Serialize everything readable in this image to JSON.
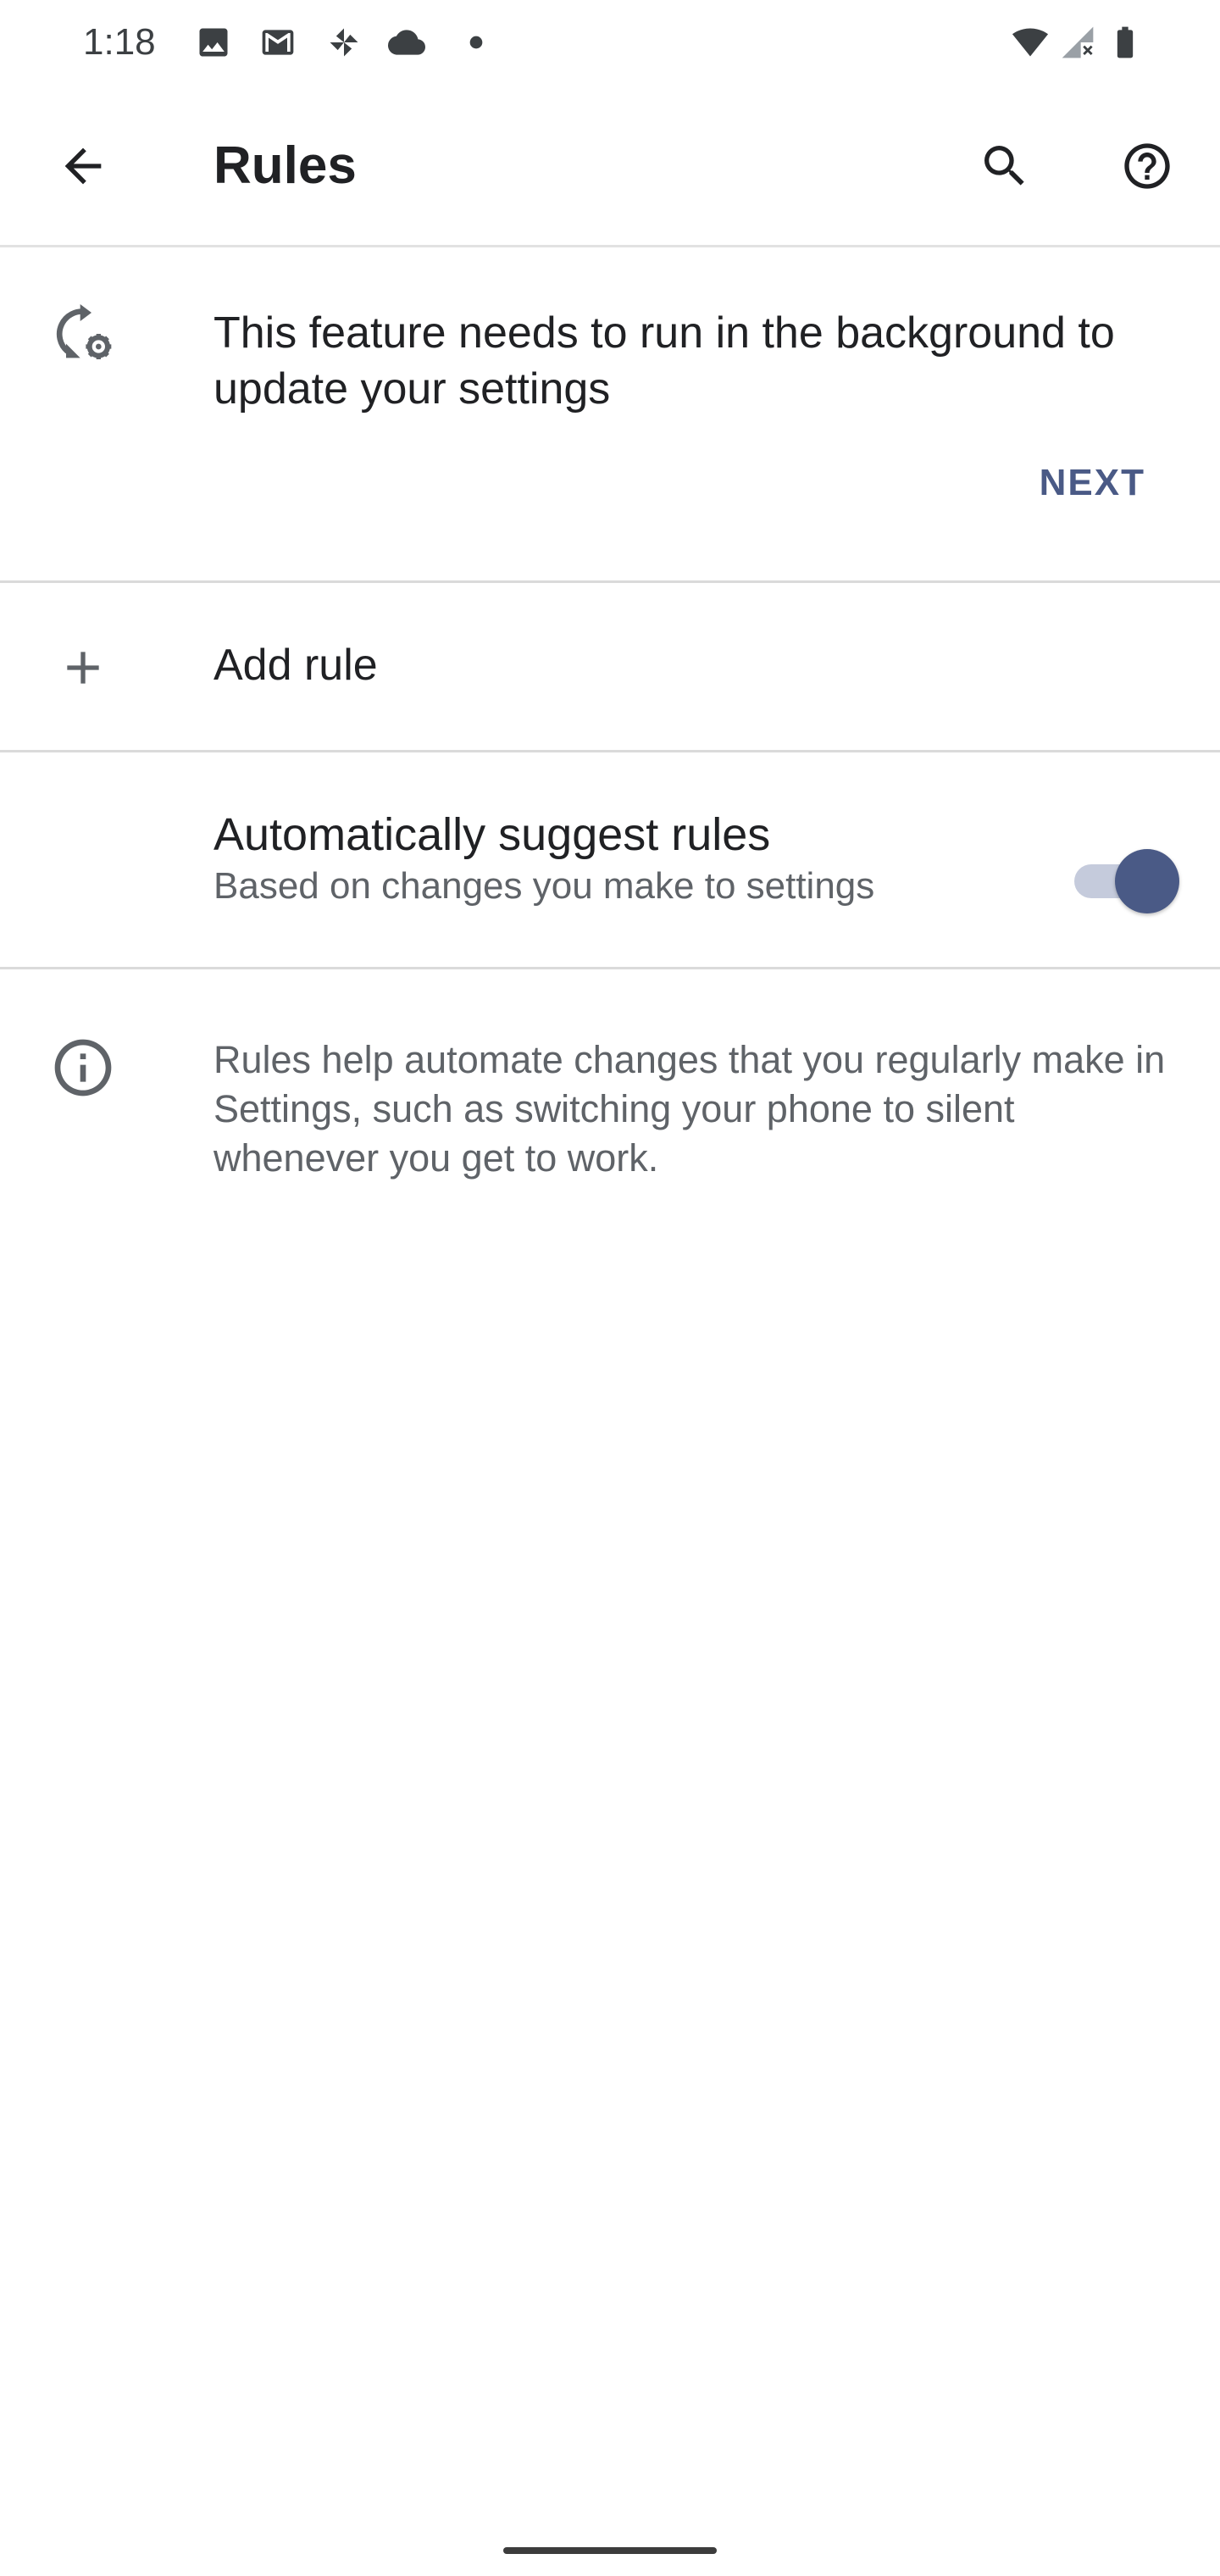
{
  "status_bar": {
    "time": "1:18",
    "left_icons": [
      "image-icon",
      "gmail-icon",
      "pinwheel-icon",
      "cloud-icon",
      "dot-icon"
    ],
    "right_icons": [
      "wifi-icon",
      "cellular-no-signal-icon",
      "battery-icon"
    ]
  },
  "app_bar": {
    "title": "Rules",
    "back_icon": "arrow-back-icon",
    "search_icon": "search-icon",
    "help_icon": "help-icon"
  },
  "banner": {
    "icon": "sync-settings-icon",
    "message": "This feature needs to run in the background to update your settings",
    "action_label": "NEXT"
  },
  "add_rule": {
    "icon": "plus-icon",
    "label": "Add rule"
  },
  "suggest_rules": {
    "title": "Automatically suggest rules",
    "subtitle": "Based on changes you make to settings",
    "enabled": true
  },
  "info": {
    "icon": "info-icon",
    "text": "Rules help automate changes that you regularly make in Settings, such as switching your phone to silent whenever you get to work."
  },
  "colors": {
    "accent": "#4a5a86",
    "accent_track": "#c5cbdc",
    "divider": "#dadada",
    "text_primary": "#202124",
    "text_secondary": "#5f6368"
  }
}
